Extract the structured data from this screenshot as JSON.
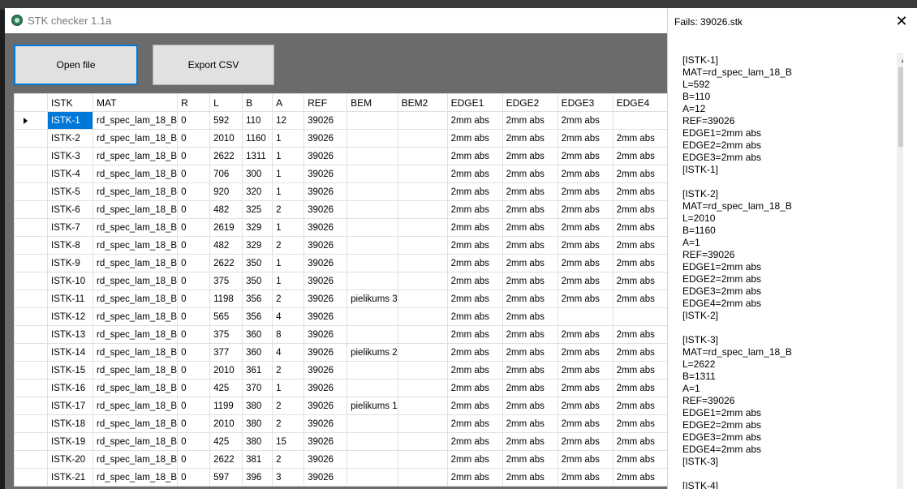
{
  "window": {
    "title": "STK checker 1.1a",
    "buttons": {
      "open": "Open file",
      "export": "Export CSV"
    }
  },
  "columns": [
    "ISTK",
    "MAT",
    "R",
    "L",
    "B",
    "A",
    "REF",
    "BEM",
    "BEM2",
    "EDGE1",
    "EDGE2",
    "EDGE3",
    "EDGE4"
  ],
  "rows": [
    [
      "ISTK-1",
      "rd_spec_lam_18_B",
      "0",
      "592",
      "110",
      "12",
      "39026",
      "",
      "",
      "2mm abs",
      "2mm abs",
      "2mm abs",
      ""
    ],
    [
      "ISTK-2",
      "rd_spec_lam_18_B",
      "0",
      "2010",
      "1160",
      "1",
      "39026",
      "",
      "",
      "2mm abs",
      "2mm abs",
      "2mm abs",
      "2mm abs"
    ],
    [
      "ISTK-3",
      "rd_spec_lam_18_B",
      "0",
      "2622",
      "1311",
      "1",
      "39026",
      "",
      "",
      "2mm abs",
      "2mm abs",
      "2mm abs",
      "2mm abs"
    ],
    [
      "ISTK-4",
      "rd_spec_lam_18_B",
      "0",
      "706",
      "300",
      "1",
      "39026",
      "",
      "",
      "2mm abs",
      "2mm abs",
      "2mm abs",
      "2mm abs"
    ],
    [
      "ISTK-5",
      "rd_spec_lam_18_B",
      "0",
      "920",
      "320",
      "1",
      "39026",
      "",
      "",
      "2mm abs",
      "2mm abs",
      "2mm abs",
      "2mm abs"
    ],
    [
      "ISTK-6",
      "rd_spec_lam_18_B",
      "0",
      "482",
      "325",
      "2",
      "39026",
      "",
      "",
      "2mm abs",
      "2mm abs",
      "2mm abs",
      "2mm abs"
    ],
    [
      "ISTK-7",
      "rd_spec_lam_18_B",
      "0",
      "2619",
      "329",
      "1",
      "39026",
      "",
      "",
      "2mm abs",
      "2mm abs",
      "2mm abs",
      "2mm abs"
    ],
    [
      "ISTK-8",
      "rd_spec_lam_18_B",
      "0",
      "482",
      "329",
      "2",
      "39026",
      "",
      "",
      "2mm abs",
      "2mm abs",
      "2mm abs",
      "2mm abs"
    ],
    [
      "ISTK-9",
      "rd_spec_lam_18_B",
      "0",
      "2622",
      "350",
      "1",
      "39026",
      "",
      "",
      "2mm abs",
      "2mm abs",
      "2mm abs",
      "2mm abs"
    ],
    [
      "ISTK-10",
      "rd_spec_lam_18_B",
      "0",
      "375",
      "350",
      "1",
      "39026",
      "",
      "",
      "2mm abs",
      "2mm abs",
      "2mm abs",
      "2mm abs"
    ],
    [
      "ISTK-11",
      "rd_spec_lam_18_B",
      "0",
      "1198",
      "356",
      "2",
      "39026",
      "pielikums 3",
      "",
      "2mm abs",
      "2mm abs",
      "2mm abs",
      "2mm abs"
    ],
    [
      "ISTK-12",
      "rd_spec_lam_18_B",
      "0",
      "565",
      "356",
      "4",
      "39026",
      "",
      "",
      "2mm abs",
      "2mm abs",
      "",
      ""
    ],
    [
      "ISTK-13",
      "rd_spec_lam_18_B",
      "0",
      "375",
      "360",
      "8",
      "39026",
      "",
      "",
      "2mm abs",
      "2mm abs",
      "2mm abs",
      "2mm abs"
    ],
    [
      "ISTK-14",
      "rd_spec_lam_18_B",
      "0",
      "377",
      "360",
      "4",
      "39026",
      "pielikums 2",
      "",
      "2mm abs",
      "2mm abs",
      "2mm abs",
      "2mm abs"
    ],
    [
      "ISTK-15",
      "rd_spec_lam_18_B",
      "0",
      "2010",
      "361",
      "2",
      "39026",
      "",
      "",
      "2mm abs",
      "2mm abs",
      "2mm abs",
      "2mm abs"
    ],
    [
      "ISTK-16",
      "rd_spec_lam_18_B",
      "0",
      "425",
      "370",
      "1",
      "39026",
      "",
      "",
      "2mm abs",
      "2mm abs",
      "2mm abs",
      "2mm abs"
    ],
    [
      "ISTK-17",
      "rd_spec_lam_18_B",
      "0",
      "1199",
      "380",
      "2",
      "39026",
      "pielikums 1",
      "",
      "2mm abs",
      "2mm abs",
      "2mm abs",
      "2mm abs"
    ],
    [
      "ISTK-18",
      "rd_spec_lam_18_B",
      "0",
      "2010",
      "380",
      "2",
      "39026",
      "",
      "",
      "2mm abs",
      "2mm abs",
      "2mm abs",
      "2mm abs"
    ],
    [
      "ISTK-19",
      "rd_spec_lam_18_B",
      "0",
      "425",
      "380",
      "15",
      "39026",
      "",
      "",
      "2mm abs",
      "2mm abs",
      "2mm abs",
      "2mm abs"
    ],
    [
      "ISTK-20",
      "rd_spec_lam_18_B",
      "0",
      "2622",
      "381",
      "2",
      "39026",
      "",
      "",
      "2mm abs",
      "2mm abs",
      "2mm abs",
      "2mm abs"
    ],
    [
      "ISTK-21",
      "rd_spec_lam_18_B",
      "0",
      "597",
      "396",
      "3",
      "39026",
      "",
      "",
      "2mm abs",
      "2mm abs",
      "2mm abs",
      "2mm abs"
    ]
  ],
  "side": {
    "title": "Fails: 39026.stk",
    "lines": [
      "[ISTK-1]",
      "MAT=rd_spec_lam_18_B",
      "L=592",
      "B=110",
      "A=12",
      "REF=39026",
      "EDGE1=2mm abs",
      "EDGE2=2mm abs",
      "EDGE3=2mm abs",
      "[ISTK-1]",
      "",
      "[ISTK-2]",
      "MAT=rd_spec_lam_18_B",
      "L=2010",
      "B=1160",
      "A=1",
      "REF=39026",
      "EDGE1=2mm abs",
      "EDGE2=2mm abs",
      "EDGE3=2mm abs",
      "EDGE4=2mm abs",
      "[ISTK-2]",
      "",
      "[ISTK-3]",
      "MAT=rd_spec_lam_18_B",
      "L=2622",
      "B=1311",
      "A=1",
      "REF=39026",
      "EDGE1=2mm abs",
      "EDGE2=2mm abs",
      "EDGE3=2mm abs",
      "EDGE4=2mm abs",
      "[ISTK-3]",
      "",
      "[ISTK-4]"
    ]
  }
}
